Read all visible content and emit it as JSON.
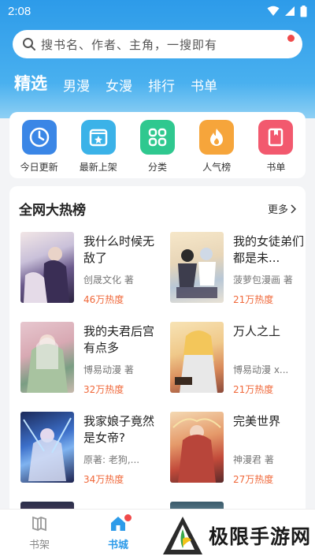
{
  "status_bar": {
    "time": "2:08"
  },
  "search": {
    "placeholder": "搜书名、作者、主角，一搜即有"
  },
  "tabs": [
    {
      "label": "精选",
      "active": true
    },
    {
      "label": "男漫"
    },
    {
      "label": "女漫"
    },
    {
      "label": "排行"
    },
    {
      "label": "书单"
    }
  ],
  "quick_links": [
    {
      "label": "今日更新",
      "icon": "clock-icon",
      "color": "#3a86e6"
    },
    {
      "label": "最新上架",
      "icon": "new-shelf-icon",
      "color": "#3bb2e8"
    },
    {
      "label": "分类",
      "icon": "category-icon",
      "color": "#2fc88f"
    },
    {
      "label": "人气榜",
      "icon": "flame-icon",
      "color": "#f6a53b"
    },
    {
      "label": "书单",
      "icon": "booklist-icon",
      "color": "#f2596e"
    }
  ],
  "hot": {
    "title": "全网大热榜",
    "more": "更多",
    "books": [
      {
        "title": "我什么时候无敌了",
        "author": "创晟文化 著",
        "heat": "46万热度"
      },
      {
        "title": "我的女徒弟们都是未...",
        "author": "菠萝包漫画 著",
        "heat": "21万热度"
      },
      {
        "title": "我的夫君后宫有点多",
        "author": "博易动漫 著",
        "heat": "32万热度"
      },
      {
        "title": "万人之上",
        "author": "博易动漫 x...",
        "heat": "21万热度"
      },
      {
        "title": "我家娘子竟然是女帝?",
        "author": "原著: 老狗,...",
        "heat": "34万热度"
      },
      {
        "title": "完美世界",
        "author": "神漫君 著",
        "heat": "27万热度"
      }
    ]
  },
  "tabbar": {
    "bookshelf": "书架",
    "bookcity": "书城"
  },
  "watermark": {
    "text": "极限手游网"
  },
  "colors": {
    "accent": "#2d9be9",
    "heat": "#f0683a",
    "badge": "#f04a4a"
  }
}
